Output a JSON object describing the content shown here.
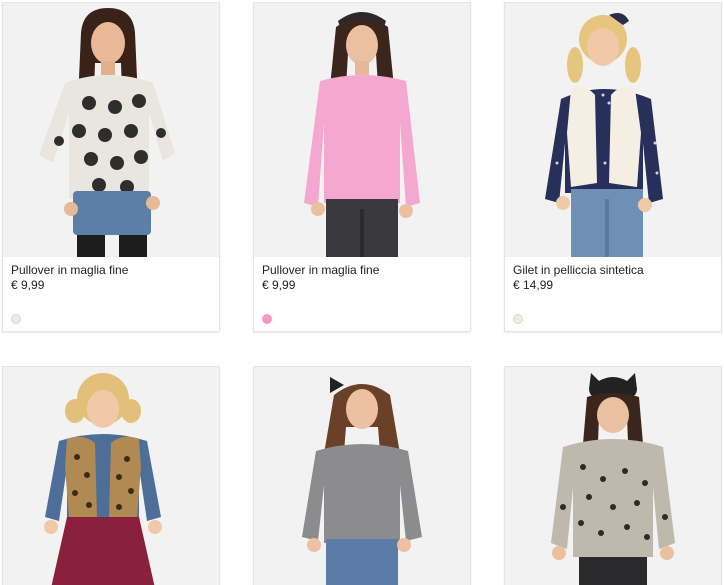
{
  "products": [
    {
      "name": "Pullover in maglia fine",
      "price": "€ 9,99",
      "swatch_color": "#ececec",
      "image": "girl-cat-print-sweater-photo"
    },
    {
      "name": "Pullover in maglia fine",
      "price": "€ 9,99",
      "swatch_color": "#f29ac2",
      "image": "girl-pink-sweater-photo"
    },
    {
      "name": "Gilet in pelliccia sintetica",
      "price": "€ 14,99",
      "swatch_color": "#f1ece0",
      "image": "girl-faux-fur-vest-photo"
    },
    {
      "image": "girl-leopard-vest-photo"
    },
    {
      "image": "girl-grey-sweater-photo"
    },
    {
      "image": "girl-polka-dot-jacket-photo"
    }
  ]
}
